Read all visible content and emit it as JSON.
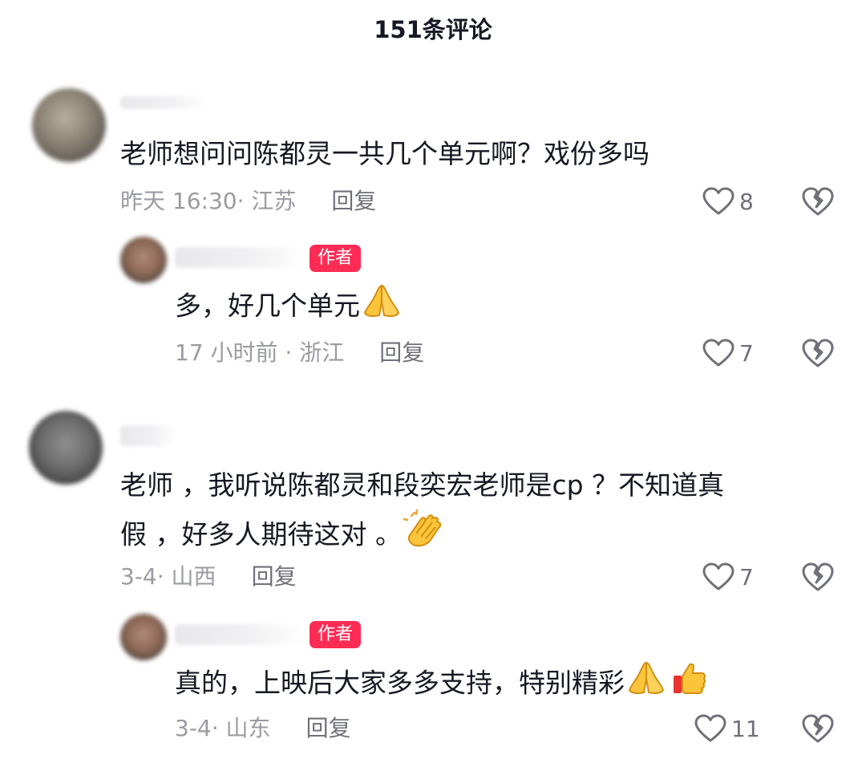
{
  "header": {
    "title": "151条评论"
  },
  "comments": [
    {
      "text": "老师想问问陈都灵一共几个单元啊？戏份多吗",
      "time": "昨天 16:30",
      "location": "江苏",
      "reply_label": "回复",
      "likes": "8",
      "replies": [
        {
          "author_badge": "作者",
          "text": "多，好几个单元",
          "emoji": "hands-pressed-together-emoji",
          "time": "17 小时前",
          "location": "浙江",
          "reply_label": "回复",
          "likes": "7"
        }
      ]
    },
    {
      "text_line1": "老师 ，我听说陈都灵和段奕宏老师是cp ？不知道真",
      "text_line2": "假 ，好多人期待这对 。",
      "emoji": "clapping-hands-emoji",
      "time": "3-4",
      "location": "山西",
      "reply_label": "回复",
      "likes": "7",
      "replies": [
        {
          "author_badge": "作者",
          "text": "真的，上映后大家多多支持，特别精彩",
          "emojis": [
            "hands-pressed-together-emoji",
            "thumbs-up-emoji"
          ],
          "time": "3-4",
          "location": "山东",
          "reply_label": "回复",
          "likes": "11"
        }
      ]
    }
  ],
  "colors": {
    "badge": "#fe2c55",
    "meta_text": "#9a9ba1",
    "icon": "#6f7078"
  }
}
